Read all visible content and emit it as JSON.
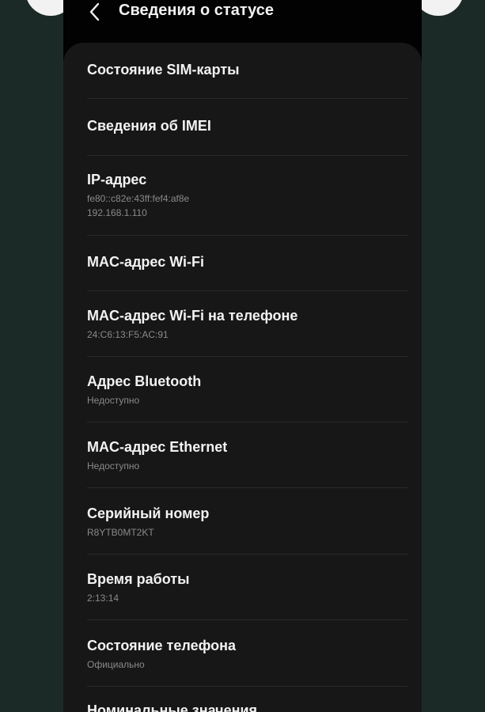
{
  "header": {
    "title": "Сведения о статусе"
  },
  "items": [
    {
      "title": "Состояние SIM-карты"
    },
    {
      "title": "Сведения об IMEI"
    },
    {
      "title": "IP-адрес",
      "sub1": "fe80::c82e:43ff:fef4:af8e",
      "sub2": "192.168.1.110"
    },
    {
      "title": "MAC-адрес Wi-Fi"
    },
    {
      "title": "MAC-адрес Wi-Fi на телефоне",
      "sub1": "24:C6:13:F5:AC:91"
    },
    {
      "title": "Адрес Bluetooth",
      "sub1": "Недоступно"
    },
    {
      "title": "MAC-адрес Ethernet",
      "sub1": "Недоступно"
    },
    {
      "title": "Серийный номер",
      "sub1": "R8YTB0MT2KT"
    },
    {
      "title": "Время работы",
      "sub1": "2:13:14"
    },
    {
      "title": "Состояние телефона",
      "sub1": "Официально"
    },
    {
      "title": "Номинальные значения"
    }
  ]
}
